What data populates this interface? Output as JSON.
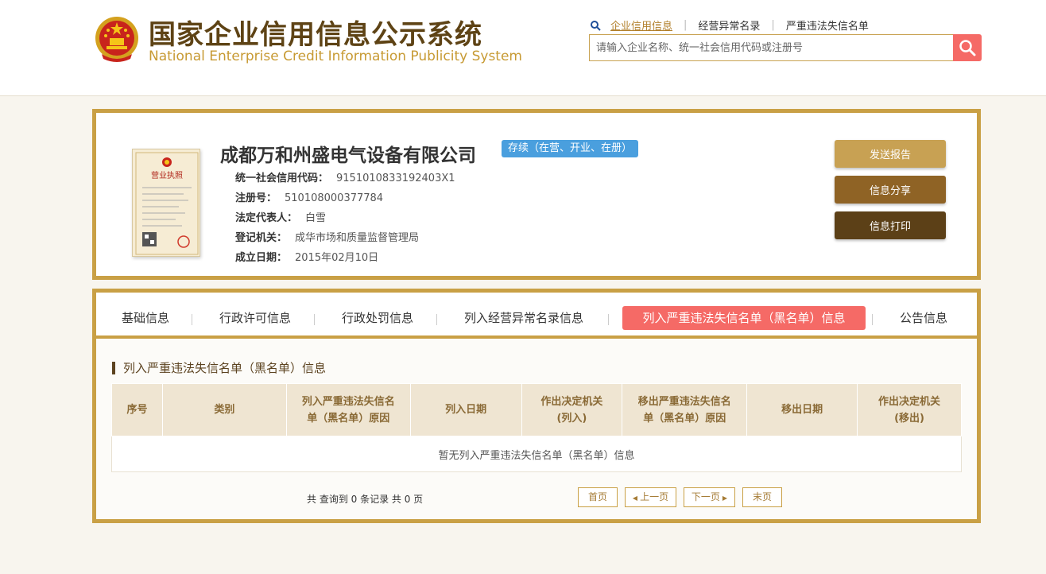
{
  "header": {
    "title_cn": "国家企业信用信息公示系统",
    "title_en": "National Enterprise Credit Information Publicity System",
    "links": [
      "企业信用信息",
      "经营异常名录",
      "严重违法失信名单"
    ],
    "search_placeholder": "请输入企业名称、统一社会信用代码或注册号"
  },
  "company": {
    "name": "成都万和州盛电气设备有限公司",
    "status": "存续（在营、开业、在册）",
    "fields": [
      {
        "label": "统一社会信用代码：",
        "value": "9151010833192403X1"
      },
      {
        "label": "注册号：",
        "value": "510108000377784"
      },
      {
        "label": "法定代表人：",
        "value": "白雪"
      },
      {
        "label": "登记机关：",
        "value": "成华市场和质量监督管理局"
      },
      {
        "label": "成立日期：",
        "value": "2015年02月10日"
      }
    ],
    "license_title": "营业执照",
    "actions": {
      "report": "发送报告",
      "share": "信息分享",
      "print": "信息打印"
    }
  },
  "tabs": [
    "基础信息",
    "行政许可信息",
    "行政处罚信息",
    "列入经营异常名录信息",
    "列入严重违法失信名单（黑名单）信息",
    "公告信息"
  ],
  "section": {
    "title": "列入严重违法失信名单（黑名单）信息",
    "columns": [
      [
        "序号"
      ],
      [
        "类别"
      ],
      [
        "列入严重违法失信名",
        "单（黑名单）原因"
      ],
      [
        "列入日期"
      ],
      [
        "作出决定机关",
        "(列入)"
      ],
      [
        "移出严重违法失信名",
        "单（黑名单）原因"
      ],
      [
        "移出日期"
      ],
      [
        "作出决定机关",
        "(移出)"
      ]
    ],
    "empty_text": "暂无列入严重违法失信名单（黑名单）信息"
  },
  "pager": {
    "summary": "共 查询到 0 条记录 共 0 页",
    "first": "首页",
    "prev": "上一页",
    "next": "下一页",
    "last": "末页"
  },
  "colors": {
    "gold": "#c9a045",
    "accent_red": "#f56a66",
    "badge_blue": "#4a9fde",
    "brown_dark": "#5c4017"
  }
}
